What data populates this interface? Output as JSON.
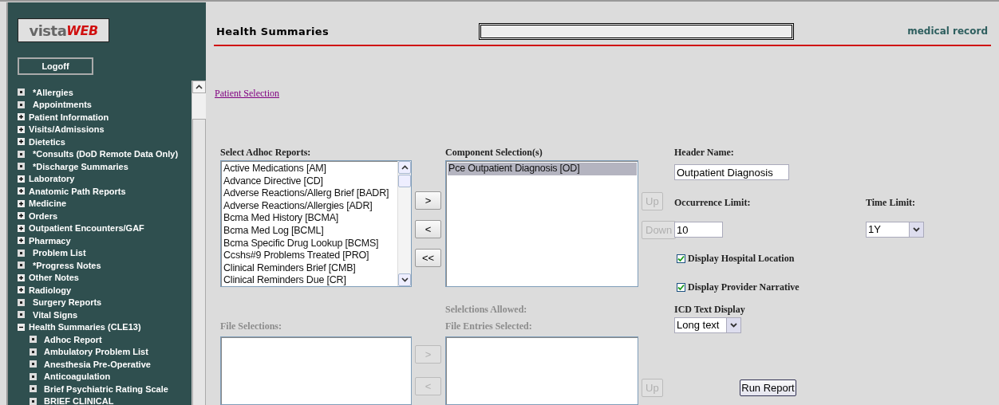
{
  "sidebar": {
    "logo": {
      "part_1": "vista",
      "part_2": "WEB"
    },
    "logoff_button": "Logoff",
    "nav_items": [
      {
        "label": "*Allergies",
        "kind": "leaf"
      },
      {
        "label": "Appointments",
        "kind": "leaf"
      },
      {
        "label": "Patient Information",
        "kind": "collapsed"
      },
      {
        "label": "Visits/Admissions",
        "kind": "collapsed"
      },
      {
        "label": "Dietetics",
        "kind": "collapsed"
      },
      {
        "label": "*Consults (DoD Remote Data Only)",
        "kind": "leaf"
      },
      {
        "label": "*Discharge Summaries",
        "kind": "leaf"
      },
      {
        "label": "Laboratory",
        "kind": "collapsed"
      },
      {
        "label": "Anatomic Path Reports",
        "kind": "collapsed"
      },
      {
        "label": "Medicine",
        "kind": "collapsed"
      },
      {
        "label": "Orders",
        "kind": "collapsed"
      },
      {
        "label": "Outpatient Encounters/GAF",
        "kind": "collapsed"
      },
      {
        "label": "Pharmacy",
        "kind": "collapsed"
      },
      {
        "label": "Problem List",
        "kind": "leaf"
      },
      {
        "label": "*Progress Notes",
        "kind": "leaf"
      },
      {
        "label": "Other Notes",
        "kind": "collapsed"
      },
      {
        "label": "Radiology",
        "kind": "collapsed"
      },
      {
        "label": "Surgery Reports",
        "kind": "leaf"
      },
      {
        "label": "Vital Signs",
        "kind": "leaf"
      },
      {
        "label": "Health Summaries (CLE13)",
        "kind": "expanded",
        "children": [
          {
            "label": "Adhoc Report",
            "kind": "leaf"
          },
          {
            "label": "Ambulatory Problem List",
            "kind": "leaf"
          },
          {
            "label": "Anesthesia Pre-Operative",
            "kind": "leaf"
          },
          {
            "label": "Anticoagulation",
            "kind": "leaf"
          },
          {
            "label": "Brief Psychiatric Rating Scale",
            "kind": "leaf"
          },
          {
            "label": "BRIEF CLINICAL",
            "kind": "leaf"
          }
        ]
      }
    ]
  },
  "header": {
    "title": "Health Summaries",
    "progress": {
      "level": 0
    },
    "brand": "medical record"
  },
  "patient_link": "Patient Selection",
  "adhoc_reports": {
    "label": "Select Adhoc Reports:",
    "items": [
      {
        "text": "Active Medications [AM]",
        "selected": false
      },
      {
        "text": "Advance Directive [CD]",
        "selected": false
      },
      {
        "text": "Adverse Reactions/Allerg Brief [BADR]",
        "selected": false
      },
      {
        "text": "Adverse Reactions/Allergies [ADR]",
        "selected": false
      },
      {
        "text": "Bcma Med History [BCMA]",
        "selected": false
      },
      {
        "text": "Bcma Med Log [BCML]",
        "selected": false
      },
      {
        "text": "Bcma Specific Drug Lookup [BCMS]",
        "selected": false
      },
      {
        "text": "Ccshs#9 Problems Treated [PRO]",
        "selected": false
      },
      {
        "text": "Clinical Reminders Brief [CMB]",
        "selected": false
      },
      {
        "text": "Clinical Reminders Due [CR]",
        "selected": false
      }
    ]
  },
  "move_buttons": [
    {
      "label": ">",
      "disabled": false
    },
    {
      "label": "<",
      "disabled": false
    },
    {
      "label": "<<",
      "disabled": false
    }
  ],
  "component_selection": {
    "label": "Component Selection(s)",
    "items": [
      {
        "text": "Pce Outpatient Diagnosis [OD]",
        "selected": true
      }
    ]
  },
  "order_buttons": [
    {
      "label": "Up",
      "disabled": true
    },
    {
      "label": "Down",
      "disabled": true
    }
  ],
  "header_name": {
    "label": "Header Name:",
    "value": "Outpatient Diagnosis"
  },
  "occurrence_limit": {
    "label": "Occurrence Limit:",
    "value": "10"
  },
  "time_limit": {
    "label": "Time Limit:",
    "value": "1Y"
  },
  "options": [
    {
      "label": "Display Hospital Location",
      "checked": true
    },
    {
      "label": "Display Provider Narrative",
      "checked": true
    }
  ],
  "selections_allowed": {
    "label": "Selelctions Allowed:",
    "disabled": true
  },
  "icd_text_display": {
    "label": "ICD Text Display",
    "value": "Long text"
  },
  "file_selections": {
    "label": "File Selections:",
    "disabled": true
  },
  "file_entries": {
    "label": "File Entries Selected:",
    "disabled": true
  },
  "file_move_buttons": [
    {
      "label": ">",
      "disabled": true
    },
    {
      "label": "<",
      "disabled": true
    }
  ],
  "file_up_button": {
    "label": "Up",
    "disabled": true
  },
  "run_report_button": "Run Report"
}
